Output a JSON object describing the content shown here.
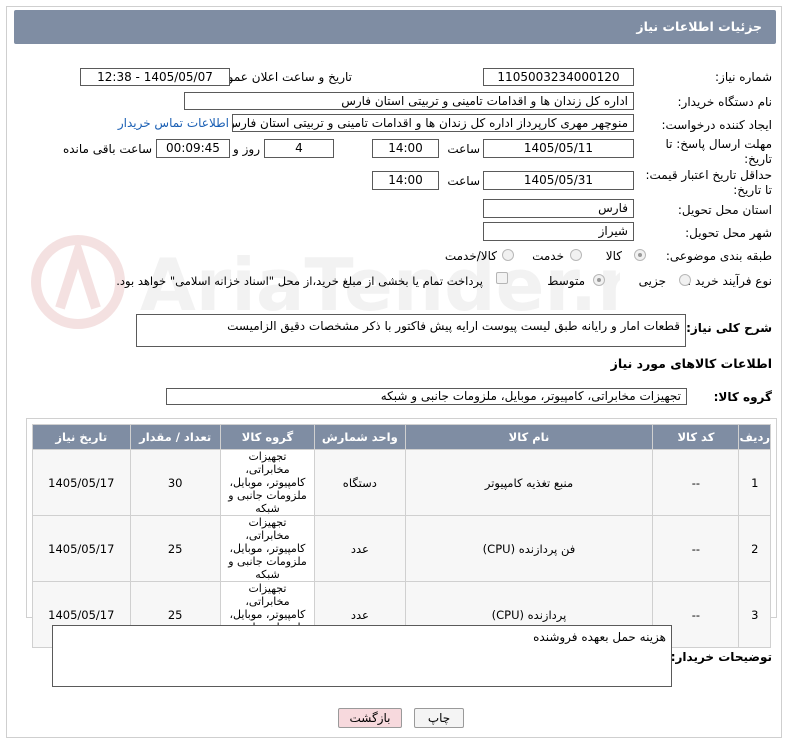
{
  "header": {
    "title": "جزئیات اطلاعات نیاز"
  },
  "fields": {
    "need_number_label": "شماره نیاز:",
    "need_number": "1105003234000120",
    "announce_label": "تاریخ و ساعت اعلان عمومی:",
    "announce_value": "1405/05/07 - 12:38",
    "buyer_org_label": "نام دستگاه خریدار:",
    "buyer_org": "اداره کل زندان ها و اقدامات تامینی و تربیتی استان فارس",
    "creator_label": "ایجاد کننده درخواست:",
    "creator": "منوچهر  مهری  کارپرداز اداره کل زندان ها و اقدامات تامینی و تربیتی استان فارس",
    "contact_link": "اطلاعات تماس خریدار",
    "reply_deadline_label_1": "مهلت ارسال پاسخ: تا",
    "reply_deadline_label_2": "تاریخ:",
    "reply_date": "1405/05/11",
    "time_label": "ساعت",
    "reply_time": "14:00",
    "days_value": "4",
    "days_label": "روز و",
    "remaining_time": "00:09:45",
    "remaining_label": "ساعت باقی مانده",
    "price_validity_label_1": "حداقل تاریخ اعتبار قیمت:",
    "price_validity_label_2": "تا تاریخ:",
    "price_date": "1405/05/31",
    "price_time": "14:00",
    "province_label": "استان محل تحویل:",
    "province": "فارس",
    "city_label": "شهر محل تحویل:",
    "city": "شیراز",
    "category_label": "طبقه بندی موضوعی:",
    "category_options": [
      "کالا",
      "خدمت",
      "کالا/خدمت"
    ],
    "process_label": "نوع فرآیند خرید :",
    "process_options": [
      "جزیی",
      "متوسط"
    ],
    "payment_note": "پرداخت تمام یا بخشی از مبلغ خرید،از محل \"اسناد خزانه اسلامی\" خواهد بود."
  },
  "description": {
    "label": "شرح کلی نیاز:",
    "text": "قطعات امار و رایانه طبق لیست پیوست ارایه پیش فاکتور با ذکر مشخصات دقیق الزامیست"
  },
  "goods_section": {
    "title": "اطلاعات کالاهای مورد نیاز",
    "group_label": "گروه کالا:",
    "group_value": "تجهیزات مخابراتی، کامپیوتر، موبایل، ملزومات جانبی و شبکه"
  },
  "table": {
    "headers": [
      "ردیف",
      "کد کالا",
      "نام کالا",
      "واحد شمارش",
      "گروه کالا",
      "تعداد / مقدار",
      "تاریخ نیاز"
    ],
    "rows": [
      {
        "row": "1",
        "code": "--",
        "name": "منبع تغذیه کامپیوتر",
        "unit": "دستگاه",
        "group": "تجهیزات مخابراتی، کامپیوتر، موبایل، ملزومات جانبی و شبکه",
        "qty": "30",
        "date": "1405/05/17"
      },
      {
        "row": "2",
        "code": "--",
        "name": "فن پردازنده (CPU)",
        "unit": "عدد",
        "group": "تجهیزات مخابراتی، کامپیوتر، موبایل، ملزومات جانبی و شبکه",
        "qty": "25",
        "date": "1405/05/17"
      },
      {
        "row": "3",
        "code": "--",
        "name": "پردازنده (CPU)",
        "unit": "عدد",
        "group": "تجهیزات مخابراتی، کامپیوتر، موبایل، ملزومات جانبی و شبکه",
        "qty": "25",
        "date": "1405/05/17"
      }
    ]
  },
  "buyer_notes": {
    "label": "توضیحات خریدار:",
    "text": "هزینه حمل بعهده فروشنده"
  },
  "buttons": {
    "print": "چاپ",
    "back": "بازگشت"
  },
  "colors": {
    "header_bg": "#7f8da3",
    "link": "#1a5fb4",
    "back_button_bg": "#f7d9dd"
  }
}
